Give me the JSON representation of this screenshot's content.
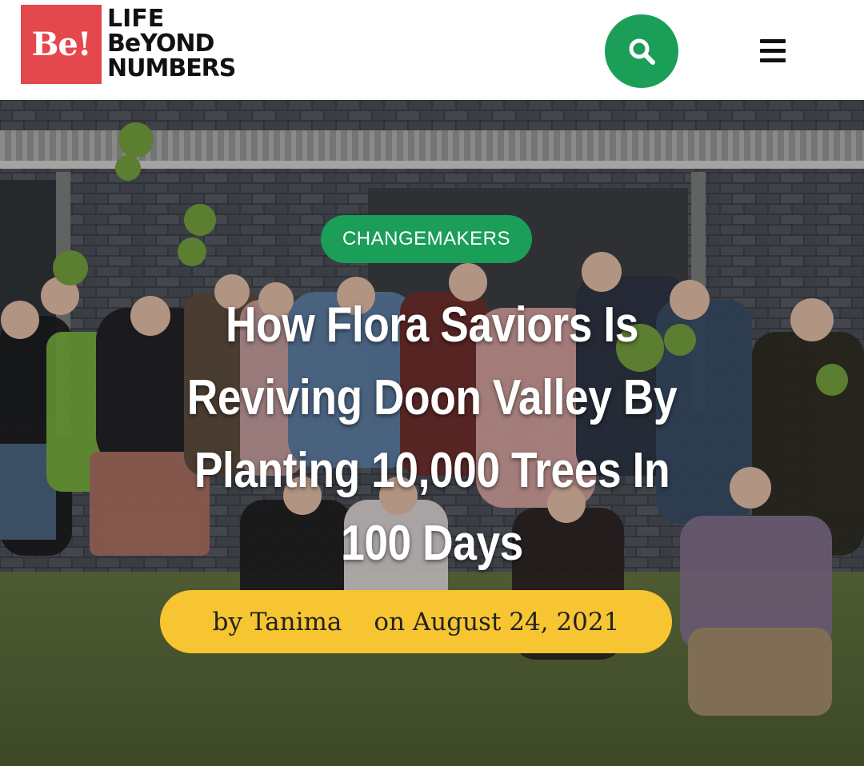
{
  "header": {
    "logo_mark": "Be!",
    "logo_lines": [
      "LIFE",
      "BeYOND",
      "NUMBERS"
    ],
    "search_icon": "search-icon",
    "menu_icon": "hamburger-menu-icon"
  },
  "article": {
    "category": "CHANGEMAKERS",
    "headline": "How Flora Saviors Is Reviving Doon Valley By Planting 10,000 Trees In 100 Days",
    "author": "by Tanima",
    "date": "on August 24, 2021"
  },
  "colors": {
    "brand_red": "#e4474c",
    "accent_green": "#1a9e58",
    "byline_yellow": "#f7c531"
  }
}
